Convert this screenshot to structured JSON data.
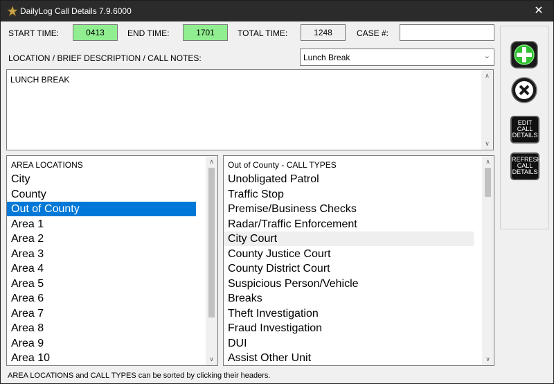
{
  "window": {
    "title": "DailyLog Call Details 7.9.6000"
  },
  "times": {
    "start_label": "START TIME:",
    "start_value": "0413",
    "end_label": "END TIME:",
    "end_value": "1701",
    "total_label": "TOTAL TIME:",
    "total_value": "1248",
    "case_label": "CASE #:",
    "case_value": ""
  },
  "notes": {
    "label": "LOCATION / BRIEF DESCRIPTION / CALL NOTES:",
    "preset_selected": "Lunch Break",
    "text": "LUNCH BREAK"
  },
  "areas": {
    "header": "AREA LOCATIONS",
    "items": [
      "City",
      "County",
      "Out of County",
      "Area 1",
      "Area 2",
      "Area 3",
      "Area 4",
      "Area 5",
      "Area 6",
      "Area 7",
      "Area 8",
      "Area 9",
      "Area 10"
    ],
    "selected": "Out of County"
  },
  "call_types": {
    "header": "Out of County - CALL TYPES",
    "items": [
      "Unobligated Patrol",
      "Traffic Stop",
      "Premise/Business Checks",
      "Radar/Traffic Enforcement",
      "City Court",
      "County Justice Court",
      "County District Court",
      "Suspicious Person/Vehicle",
      "Breaks",
      "Theft Investigation",
      "Fraud Investigation",
      "DUI",
      "Assist Other Unit"
    ],
    "highlighted": "City Court"
  },
  "buttons": {
    "add_icon": "green-plus-icon",
    "delete_icon": "white-x-icon",
    "edit_lines": [
      "EDIT",
      "CALL",
      "DETAILS"
    ],
    "refresh_lines": [
      "REFRESH",
      "CALL",
      "DETAILS"
    ]
  },
  "status": {
    "text": "AREA LOCATIONS and CALL TYPES can be sorted by clicking their headers."
  },
  "colors": {
    "titlebar": "#2b2b2b",
    "time_green": "#90ee90",
    "selection": "#0078d7",
    "plus_green": "#3cc83c"
  }
}
